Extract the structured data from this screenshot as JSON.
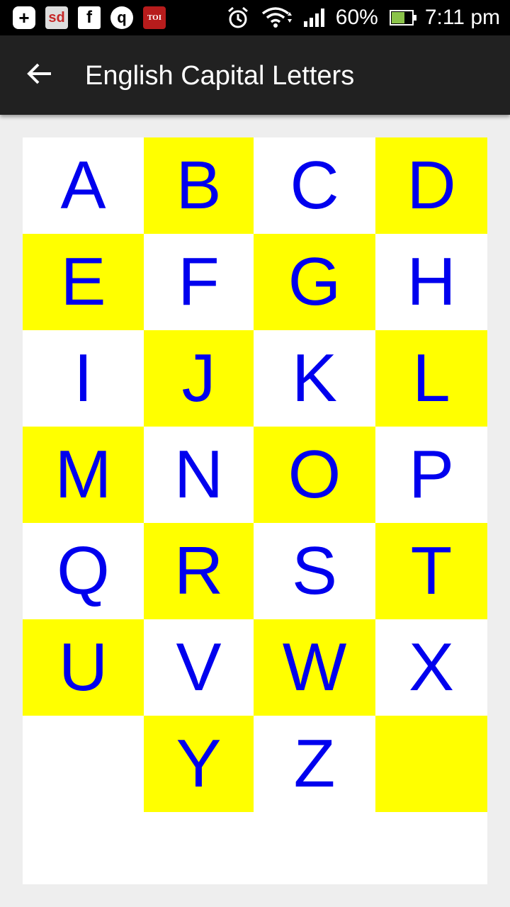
{
  "status_bar": {
    "notification_icons": [
      "plus-icon",
      "snapdeal-icon",
      "facebook-icon",
      "quora-icon",
      "toi-icon"
    ],
    "sd_label": "sd",
    "toi_label": "TOI",
    "battery_percent": "60%",
    "time": "7:11 pm"
  },
  "app_bar": {
    "back_icon": "arrow-left-icon",
    "title": "English Capital Letters"
  },
  "colors": {
    "letter": "#0000EE",
    "highlight": "#FFFF00",
    "plain": "#FFFFFF",
    "app_bar": "#212121"
  },
  "grid": {
    "cells": [
      {
        "letter": "A",
        "color": "white"
      },
      {
        "letter": "B",
        "color": "yellow"
      },
      {
        "letter": "C",
        "color": "white"
      },
      {
        "letter": "D",
        "color": "yellow"
      },
      {
        "letter": "E",
        "color": "yellow"
      },
      {
        "letter": "F",
        "color": "white"
      },
      {
        "letter": "G",
        "color": "yellow"
      },
      {
        "letter": "H",
        "color": "white"
      },
      {
        "letter": "I",
        "color": "white"
      },
      {
        "letter": "J",
        "color": "yellow"
      },
      {
        "letter": "K",
        "color": "white"
      },
      {
        "letter": "L",
        "color": "yellow"
      },
      {
        "letter": "M",
        "color": "yellow"
      },
      {
        "letter": "N",
        "color": "white"
      },
      {
        "letter": "O",
        "color": "yellow"
      },
      {
        "letter": "P",
        "color": "white"
      },
      {
        "letter": "Q",
        "color": "white"
      },
      {
        "letter": "R",
        "color": "yellow"
      },
      {
        "letter": "S",
        "color": "white"
      },
      {
        "letter": "T",
        "color": "yellow"
      },
      {
        "letter": "U",
        "color": "yellow"
      },
      {
        "letter": "V",
        "color": "white"
      },
      {
        "letter": "W",
        "color": "yellow"
      },
      {
        "letter": "X",
        "color": "white"
      },
      {
        "letter": "",
        "color": "white"
      },
      {
        "letter": "Y",
        "color": "yellow"
      },
      {
        "letter": "Z",
        "color": "white"
      },
      {
        "letter": "",
        "color": "yellow"
      }
    ]
  }
}
